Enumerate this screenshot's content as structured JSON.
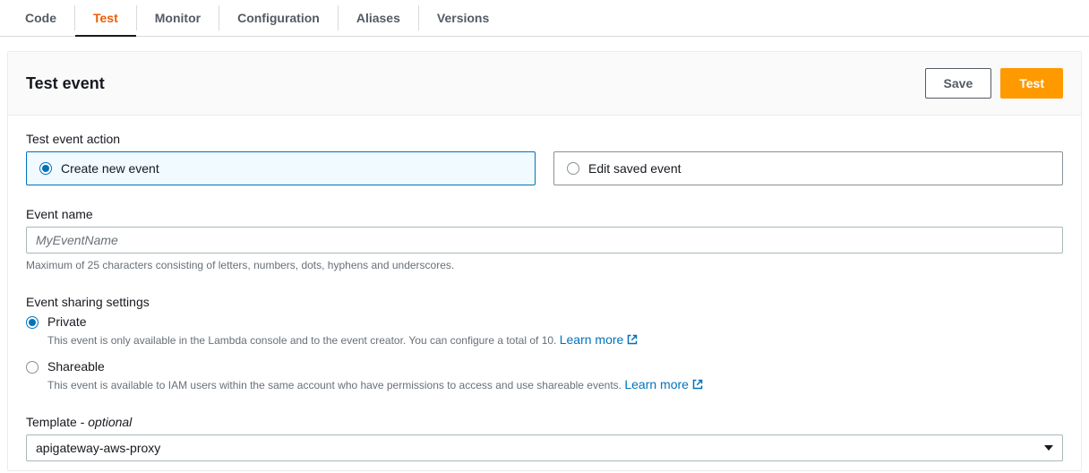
{
  "tabs": {
    "items": [
      {
        "label": "Code"
      },
      {
        "label": "Test"
      },
      {
        "label": "Monitor"
      },
      {
        "label": "Configuration"
      },
      {
        "label": "Aliases"
      },
      {
        "label": "Versions"
      }
    ]
  },
  "panel": {
    "title": "Test event",
    "save_label": "Save",
    "test_label": "Test"
  },
  "action": {
    "label": "Test event action",
    "create_label": "Create new event",
    "edit_label": "Edit saved event"
  },
  "event_name": {
    "label": "Event name",
    "placeholder": "MyEventName",
    "helper": "Maximum of 25 characters consisting of letters, numbers, dots, hyphens and underscores."
  },
  "sharing": {
    "label": "Event sharing settings",
    "private": {
      "label": "Private",
      "desc": "This event is only available in the Lambda console and to the event creator. You can configure a total of 10.",
      "learn_more": "Learn more"
    },
    "shareable": {
      "label": "Shareable",
      "desc": "This event is available to IAM users within the same account who have permissions to access and use shareable events.",
      "learn_more": "Learn more"
    }
  },
  "template": {
    "label_prefix": "Template - ",
    "label_optional": "optional",
    "value": "apigateway-aws-proxy"
  }
}
